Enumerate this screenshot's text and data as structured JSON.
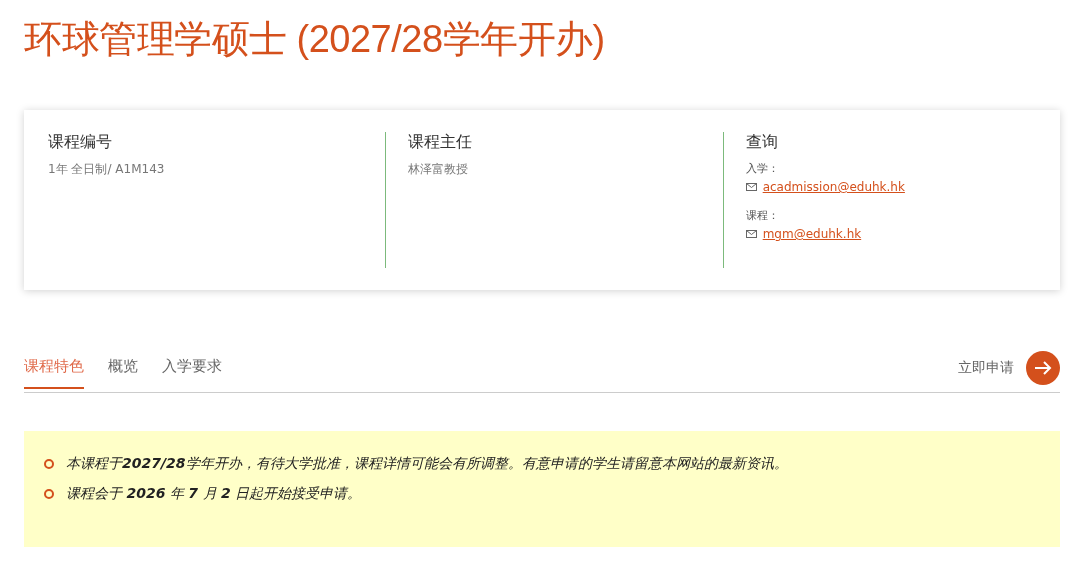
{
  "title": "环球管理学硕士 (2027/28学年开办)",
  "info": [
    {
      "kind": "text",
      "heading": "课程编号",
      "text": "1年 全日制/ A1M143"
    },
    {
      "kind": "text",
      "heading": "课程主任",
      "text": "林泽富教授"
    },
    {
      "kind": "contacts",
      "heading": "查询",
      "contacts": [
        {
          "label": "入学：",
          "email": "acadmission@eduhk.hk"
        },
        {
          "label": "课程：",
          "email": "mgm@eduhk.hk"
        }
      ]
    }
  ],
  "tabs": [
    {
      "label": "课程特色",
      "selected": true
    },
    {
      "label": "概览",
      "selected": false
    },
    {
      "label": "入学要求",
      "selected": false
    }
  ],
  "apply": {
    "label": "立即申请"
  },
  "notices": [
    "本课程于**2027/28**学年开办，有待大学批准，课程详情可能会有所调整。有意申请的学生请留意本网站的最新资讯。",
    "课程会于 **2026** 年 **7** 月 **2** 日起开始接受申请。"
  ]
}
